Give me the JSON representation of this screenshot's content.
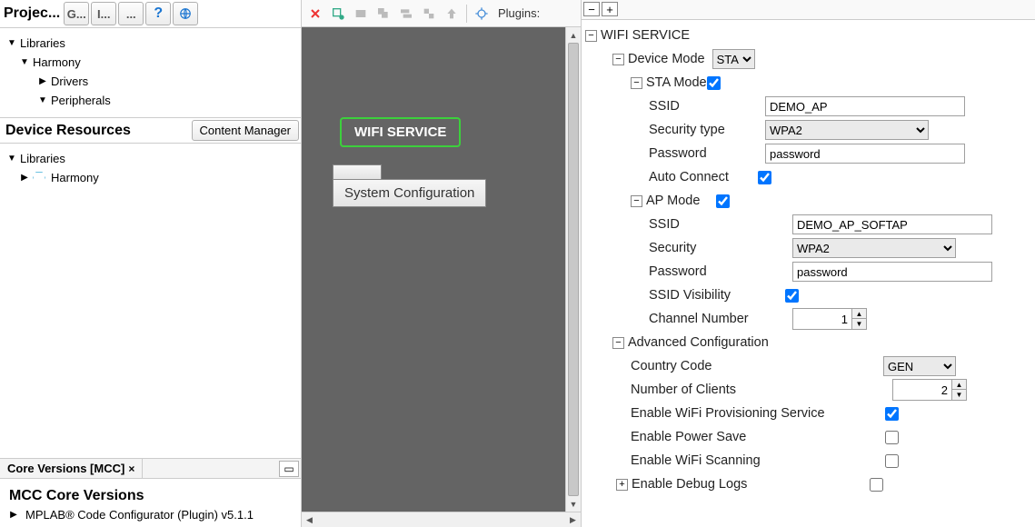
{
  "left": {
    "project_title": "Projec...",
    "toolbar": {
      "g": "G...",
      "i": "I..."
    },
    "tree": {
      "libraries": "Libraries",
      "harmony": "Harmony",
      "drivers": "Drivers",
      "peripherals": "Peripherals"
    },
    "device_resources_title": "Device Resources",
    "content_manager_btn": "Content Manager",
    "dev_tree": {
      "libraries": "Libraries",
      "harmony": "Harmony"
    },
    "core_tab": "Core Versions [MCC]",
    "mcc_title": "MCC Core Versions",
    "mcc_item": "MPLAB® Code Configurator (Plugin) v5.1.1"
  },
  "mid": {
    "plugins_label": "Plugins:",
    "wifi_box": "WIFI SERVICE",
    "sysconf_box": "System Configuration"
  },
  "props": {
    "root": "WIFI SERVICE",
    "device_mode_label": "Device Mode",
    "device_mode_value": "STA",
    "sta": {
      "label": "STA Mode",
      "checked": true,
      "ssid_label": "SSID",
      "ssid_value": "DEMO_AP",
      "security_label": "Security type",
      "security_value": "WPA2",
      "password_label": "Password",
      "password_value": "password",
      "autoconnect_label": "Auto Connect",
      "autoconnect_checked": true
    },
    "ap": {
      "label": "AP Mode",
      "checked": true,
      "ssid_label": "SSID",
      "ssid_value": "DEMO_AP_SOFTAP",
      "security_label": "Security",
      "security_value": "WPA2",
      "password_label": "Password",
      "password_value": "password",
      "ssidvis_label": "SSID Visibility",
      "ssidvis_checked": true,
      "channel_label": "Channel Number",
      "channel_value": 1
    },
    "adv": {
      "label": "Advanced Configuration",
      "country_label": "Country Code",
      "country_value": "GEN",
      "clients_label": "Number of Clients",
      "clients_value": 2,
      "prov_label": "Enable WiFi Provisioning Service",
      "prov_checked": true,
      "powersave_label": "Enable Power Save",
      "powersave_checked": false,
      "scan_label": "Enable WiFi Scanning",
      "scan_checked": false,
      "debug_label": "Enable Debug Logs",
      "debug_checked": false
    }
  },
  "chart_data": null
}
